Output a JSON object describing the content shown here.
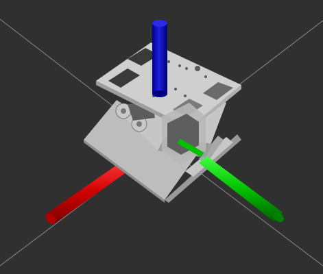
{
  "viewport": {
    "background": "#303030",
    "grid_color": "#8a8a8a",
    "model_colors": {
      "base": "#bdbdbd",
      "base_shadow": "#8e8e8e",
      "top": "#cfcfcf",
      "dark": "#6f6f6f"
    },
    "axes": [
      {
        "name": "x-axis",
        "color": "#d00000"
      },
      {
        "name": "y-axis",
        "color": "#00c000"
      },
      {
        "name": "z-axis",
        "color": "#1010c8"
      }
    ]
  }
}
